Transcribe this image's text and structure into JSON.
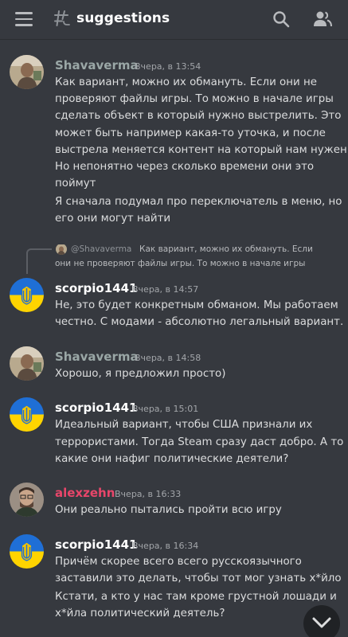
{
  "header": {
    "channel_name": "suggestions",
    "menu_icon": "hamburger-menu-icon",
    "channel_icon": "thread-channel-icon",
    "search_icon": "search-icon",
    "members_icon": "members-icon"
  },
  "colors": {
    "background": "#36393f",
    "text": "#dcddde",
    "muted": "#a3a6aa",
    "user_shavaverma": "#9aa7a6",
    "user_scorpio": "#ffffff",
    "user_alexzehn": "#e8466a"
  },
  "messages": [
    {
      "author": "Shavaverma",
      "timestamp": "Вчера, в 13:54",
      "lines": [
        "Как вариант, можно их обмануть. Если они не",
        "проверяют файлы игры. То можно в начале игры",
        "сделать объект в который нужно выстрелить. Это",
        "может быть например какая-то уточка, и после",
        "выстрела меняется контент на который нам нужен.",
        "Но непонятно через сколько времени они это",
        "поймут"
      ],
      "lines2": [
        "Я сначала подумал про переключатель в меню, но",
        "его они могут найти"
      ]
    },
    {
      "reply": {
        "author": "@Shavaverma",
        "text_line1": "Как вариант, можно их обмануть. Если",
        "text_line2": "они не проверяют файлы игры. То можно в начале игры"
      },
      "author": "scorpio1441",
      "timestamp": "Вчера, в 14:57",
      "lines": [
        "Не, это будет конкретным обманом. Мы работаем",
        "честно. С модами - абсолютно легальный вариант."
      ]
    },
    {
      "author": "Shavaverma",
      "timestamp": "Вчера, в 14:58",
      "lines": [
        "Хорошо, я предложил просто)"
      ]
    },
    {
      "author": "scorpio1441",
      "timestamp": "Вчера, в 15:01",
      "lines": [
        "Идеальный вариант, чтобы США признали их",
        "террористами. Тогда Steam сразу даст добро. А то",
        "какие они нафиг политические деятели?"
      ]
    },
    {
      "author": "alexzehn",
      "timestamp": "Вчера, в 16:33",
      "lines": [
        "Они реально пытались пройти всю игру"
      ]
    },
    {
      "author": "scorpio1441",
      "timestamp": "Вчера, в 16:34",
      "lines": [
        "Причём скорее всего всего русскоязычного",
        "заставили это делать, чтобы тот мог узнать х*йло"
      ],
      "lines2": [
        "Кстати, а кто у нас там кроме грустной лошади и",
        "х*йла политический деятель?"
      ]
    }
  ],
  "scroll_button_icon": "chevron-down-icon"
}
